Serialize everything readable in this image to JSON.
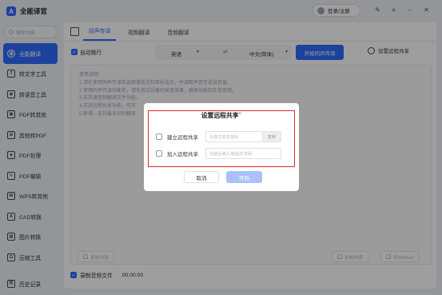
{
  "app": {
    "title": "全能译官",
    "login_label": "登录/注册"
  },
  "sidebar": {
    "search_placeholder": "搜索功能",
    "items": [
      {
        "label": "全能翻译",
        "icon": "translate-icon",
        "active": true
      },
      {
        "label": "转文字工具",
        "icon": "text-icon"
      },
      {
        "label": "转语音工具",
        "icon": "audio-icon"
      },
      {
        "label": "PDF转其他",
        "icon": "pdf-convert-icon"
      },
      {
        "label": "其他转PDF",
        "icon": "to-pdf-icon"
      },
      {
        "label": "PDF处理",
        "icon": "pdf-process-icon"
      },
      {
        "label": "PDF编辑",
        "icon": "pdf-edit-icon"
      },
      {
        "label": "WPS转其他",
        "icon": "wps-icon"
      },
      {
        "label": "CAD转换",
        "icon": "cad-icon"
      },
      {
        "label": "图片转换",
        "icon": "image-icon"
      },
      {
        "label": "压缩工具",
        "icon": "compress-icon"
      }
    ],
    "history_label": "历史记录"
  },
  "tabs": [
    "同声传译",
    "视频翻译",
    "音频翻译"
  ],
  "toolbar": {
    "auto_wrap_label": "自动换行",
    "source_lang": "英语",
    "target_lang": "中文(简体)",
    "start_label": "开始同声传译",
    "remote_share_label": "设置远程共享"
  },
  "instructions": [
    "使用说明:",
    "1.请在使用同声传译前选择源语言和目标语言，并调整声音至适当音量。",
    "2.使用同声传译功能前，请先测试设备的采音效果，确保功能的正常使用。",
    "3.支持源音频翻译文件功能。",
    "4.支持远程共享功能，可实",
    "5.新增：支持最多识别翻译"
  ],
  "bottom_buttons": {
    "copy": "复制内容",
    "export": "复制内容",
    "word": "导出Word"
  },
  "footer": {
    "record_label": "录制音频文件",
    "time": "00:00:00"
  },
  "modal": {
    "title": "设置远程共享",
    "create_label": "建立远程共享",
    "create_placeholder": "勾选生成共享码",
    "copy_label": "复制",
    "join_label": "加入远程共享",
    "join_placeholder": "勾选后输入/粘贴共享码",
    "cancel_label": "取消",
    "start_label": "开始"
  }
}
